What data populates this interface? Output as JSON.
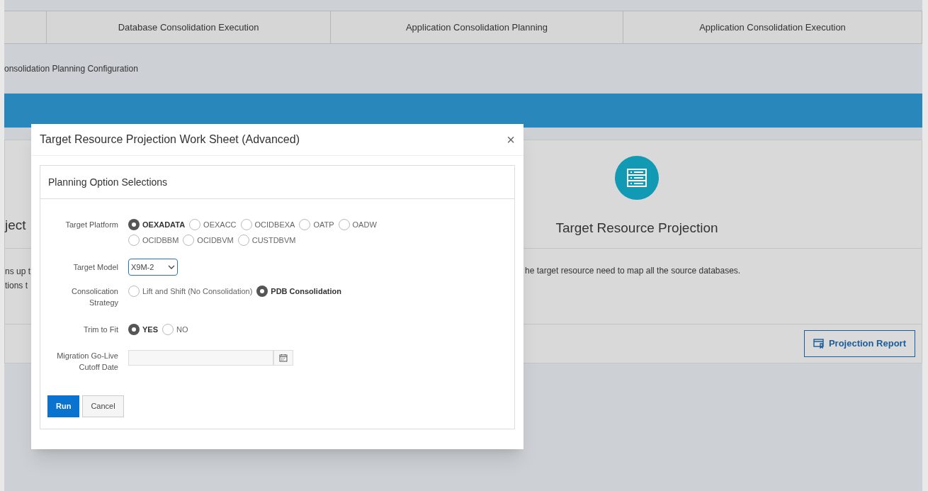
{
  "tabs": [
    {
      "label": "Database Consolidation Execution"
    },
    {
      "label": "Application Consolidation Planning"
    },
    {
      "label": "Application Consolidation Execution"
    }
  ],
  "breadcrumb": "onsolidation Planning Configuration",
  "left_card": {
    "title": "ject",
    "description_lines": [
      "ns up t",
      "tions t"
    ]
  },
  "right_card": {
    "title": "Target Resource Projection",
    "description": "he target resource need to map all the source databases.",
    "button": "Projection Report"
  },
  "dialog": {
    "title": "Target Resource Projection Work Sheet (Advanced)",
    "close": "×",
    "panel_title": "Planning Option Selections",
    "target_platform": {
      "label": "Target Platform",
      "options": [
        {
          "label": "OEXADATA",
          "selected": true
        },
        {
          "label": "OEXACC",
          "selected": false
        },
        {
          "label": "OCIDBEXA",
          "selected": false
        },
        {
          "label": "OATP",
          "selected": false
        },
        {
          "label": "OADW",
          "selected": false
        },
        {
          "label": "OCIDBBM",
          "selected": false
        },
        {
          "label": "OCIDBVM",
          "selected": false
        },
        {
          "label": "CUSTDBVM",
          "selected": false
        }
      ]
    },
    "target_model": {
      "label": "Target Model",
      "value": "X9M-2"
    },
    "strategy": {
      "label_lines": [
        "Consolication",
        "Strategy"
      ],
      "options": [
        {
          "label": "Lift and Shift (No Consolidation)",
          "selected": false
        },
        {
          "label": "PDB Consolidation",
          "selected": true
        }
      ]
    },
    "trim": {
      "label": "Trim to Fit",
      "options": [
        {
          "label": "YES",
          "selected": true
        },
        {
          "label": "NO",
          "selected": false
        }
      ]
    },
    "cutoff": {
      "label_lines": [
        "Migration Go-Live",
        "Cutoff Date"
      ]
    },
    "buttons": [
      {
        "label": "Run",
        "kind": "primary"
      },
      {
        "label": "Cancel",
        "kind": "secondary"
      }
    ]
  }
}
